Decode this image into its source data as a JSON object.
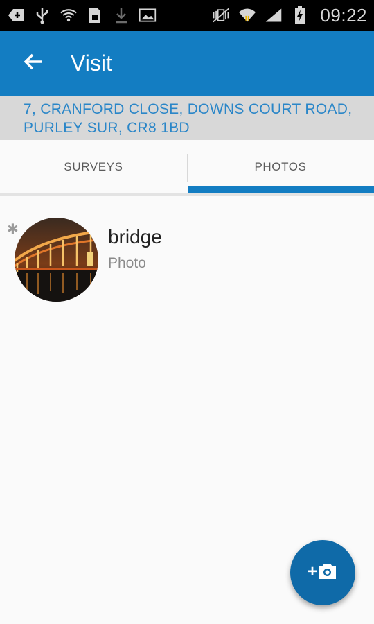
{
  "status_bar": {
    "time": "09:22",
    "icons_left": [
      "add-notification-icon",
      "usb-icon",
      "wifi-notification-icon",
      "sim-card-icon",
      "download-icon",
      "image-icon"
    ],
    "icons_right": [
      "vibrate-mute-icon",
      "wifi-icon",
      "signal-icon",
      "battery-charging-icon"
    ]
  },
  "app_bar": {
    "title": "Visit",
    "background": "#137dc2",
    "back_icon": "arrow-back-icon"
  },
  "address": {
    "line1": "7, CRANFORD CLOSE, DOWNS COURT ROAD,",
    "line2": "PURLEY SUR, CR8 1BD",
    "color": "#2a86c8"
  },
  "tabs": [
    {
      "label": "SURVEYS",
      "selected": false
    },
    {
      "label": "PHOTOS",
      "selected": true
    }
  ],
  "items": [
    {
      "title": "bridge",
      "subtitle": "Photo",
      "thumbnail": "bridge-photo-thumbnail",
      "marker": "asterisk-icon"
    }
  ],
  "fab": {
    "label": "+",
    "icon": "add-photo-icon",
    "color": "#0f6aa8"
  }
}
